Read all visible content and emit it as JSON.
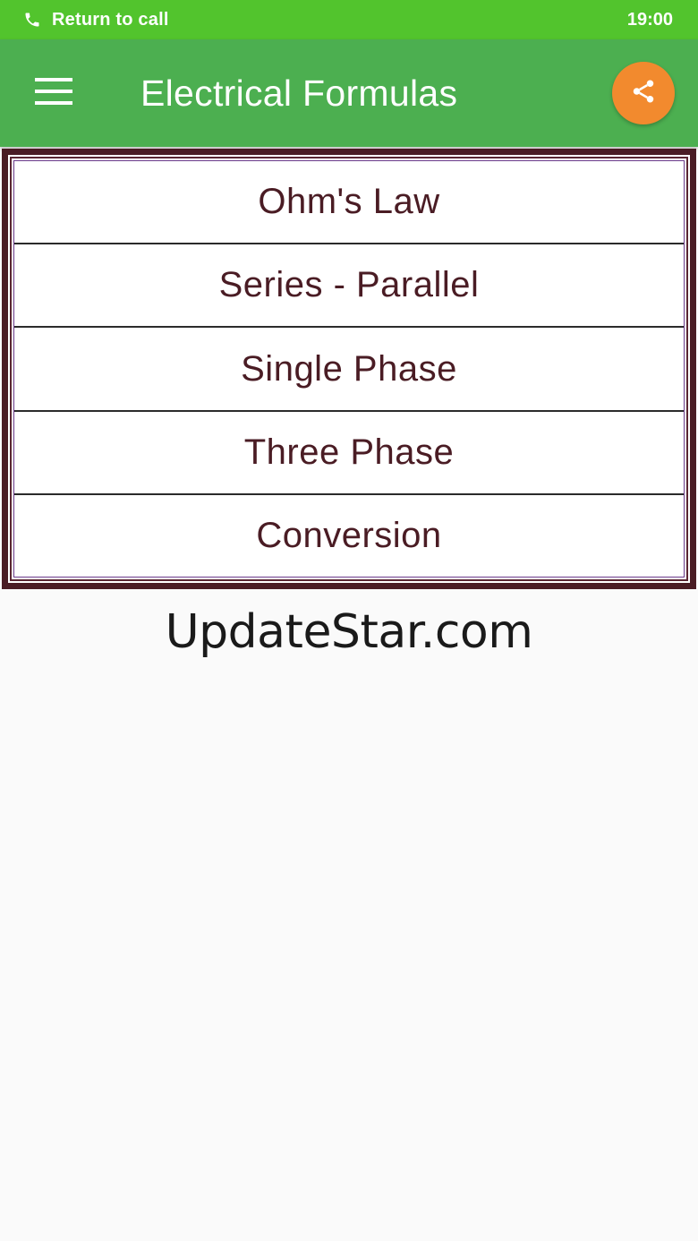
{
  "status_bar": {
    "call_text": "Return to call",
    "time": "19:00",
    "icon": "phone-icon"
  },
  "app_bar": {
    "title": "Electrical Formulas",
    "menu_icon": "hamburger-menu-icon",
    "share_icon": "share-icon",
    "share_color": "#f28a2e",
    "bar_color": "#4caf50"
  },
  "menu": {
    "items": [
      {
        "label": "Ohm's Law"
      },
      {
        "label": "Series - Parallel"
      },
      {
        "label": "Single Phase"
      },
      {
        "label": "Three Phase"
      },
      {
        "label": "Conversion"
      }
    ],
    "text_color": "#4a1c24"
  },
  "watermark": {
    "text": "UpdateStar.com"
  }
}
